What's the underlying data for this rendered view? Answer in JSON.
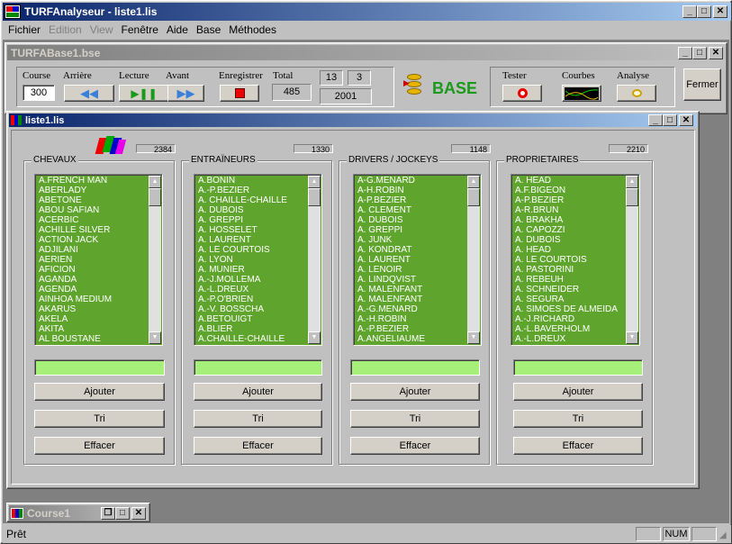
{
  "app": {
    "title": "TURFAnalyseur - liste1.lis"
  },
  "menu": {
    "items": [
      "Fichier",
      "Edition",
      "View",
      "Fenêtre",
      "Aide",
      "Base",
      "Méthodes"
    ]
  },
  "base_window": {
    "title": "TURFABase1.bse"
  },
  "toolbar": {
    "course_label": "Course",
    "course_value": "300",
    "arriere_label": "Arrière",
    "lecture_label": "Lecture",
    "avant_label": "Avant",
    "enregistrer_label": "Enregistrer",
    "total_label": "Total",
    "total_value": "485",
    "num1": "13",
    "num2": "3",
    "year": "2001",
    "base_label": "BASE",
    "tester_label": "Tester",
    "courbes_label": "Courbes",
    "analyse_label": "Analyse",
    "fermer_label": "Fermer"
  },
  "list_window": {
    "title": "liste1.lis"
  },
  "groups": [
    {
      "label": "CHEVAUX",
      "count": "2384",
      "items": [
        "A.FRENCH MAN",
        "ABERLADY",
        "ABETONE",
        "ABOU SAFIAN",
        "ACERBIC",
        "ACHILLE SILVER",
        "ACTION JACK",
        "ADJILANI",
        "AERIEN",
        "AFICION",
        "AGANDA",
        "AGENDA",
        "AINHOA MEDIUM",
        "AKARUS",
        "AKELA",
        "AKITA",
        "AL BOUSTANE"
      ]
    },
    {
      "label": "ENTRAÏNEURS",
      "count": "1330",
      "items": [
        "A.BONIN",
        "A.-P.BEZIER",
        "A. CHAILLE-CHAILLE",
        "A. DUBOIS",
        "A. GREPPI",
        "A. HOSSELET",
        "A. LAURENT",
        "A. LE COURTOIS",
        "A. LYON",
        "A. MUNIER",
        "A.-J.MOLLEMA",
        "A.-L.DREUX",
        "A.-P.O'BRIEN",
        "A.-V. BOSSCHA",
        "A.BETOUIGT",
        "A.BLIER",
        "A.CHAILLE-CHAILLE"
      ]
    },
    {
      "label": "DRIVERS / JOCKEYS",
      "count": "1148",
      "items": [
        "A-G.MENARD",
        "A-H.ROBIN",
        "A-P.BEZIER",
        "A. CLEMENT",
        "A. DUBOIS",
        "A. GREPPI",
        "A. JUNK",
        "A. KONDRAT",
        "A. LAURENT",
        "A. LENOIR",
        "A. LINDQVIST",
        "A. MALENFANT",
        "A. MALENFANT",
        "A.-G.MENARD",
        "A.-H.ROBIN",
        "A.-P.BEZIER",
        "A.ANGELIAUME"
      ]
    },
    {
      "label": "PROPRIETAIRES",
      "count": "2210",
      "items": [
        "A. HEAD",
        "A.F.BIGEON",
        "A-P.BEZIER",
        "A-R.BRUN",
        "A. BRAKHA",
        "A. CAPOZZI",
        "A. DUBOIS",
        "A. HEAD",
        "A. LE COURTOIS",
        "A. PASTORINI",
        "A. REBEUH",
        "A. SCHNEIDER",
        "A. SEGURA",
        "A. SIMOES DE ALMEIDA",
        "A.-J.RICHARD",
        "A.-L.BAVERHOLM",
        "A.-L.DREUX"
      ]
    }
  ],
  "buttons": {
    "ajouter": "Ajouter",
    "tri": "Tri",
    "effacer": "Effacer"
  },
  "minimized": {
    "title": "Course1"
  },
  "status": {
    "text": "Prêt",
    "num": "NUM"
  }
}
